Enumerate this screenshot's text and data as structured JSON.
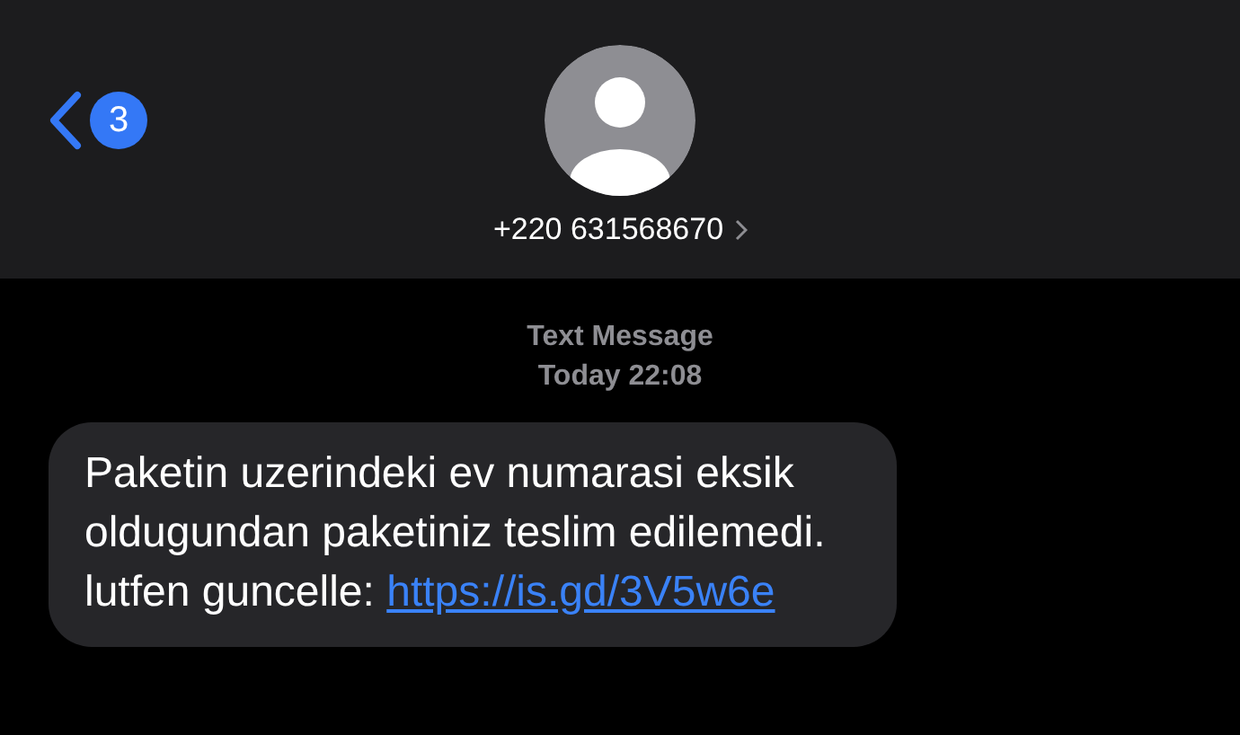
{
  "header": {
    "back_badge": "3",
    "contact": "+220 631568670"
  },
  "conversation": {
    "service": "Text Message",
    "timestamp": "Today 22:08",
    "messages": [
      {
        "text": "Paketin uzerindeki ev numarasi eksik oldugundan paketiniz teslim edilemedi. lutfen guncelle:",
        "link": "https://is.gd/3V5w6e"
      }
    ]
  }
}
